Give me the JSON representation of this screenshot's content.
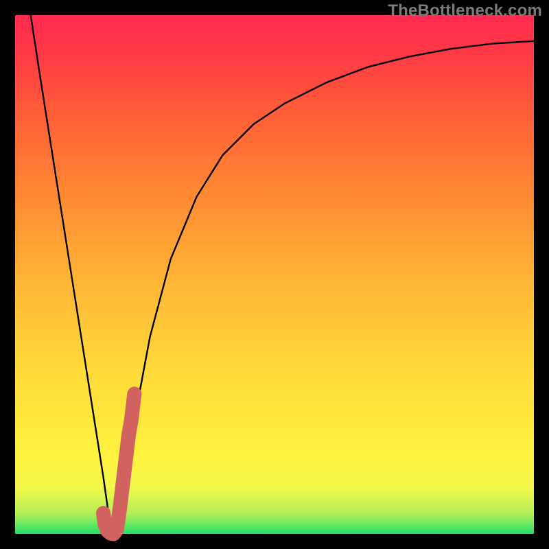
{
  "watermark": {
    "text": "TheBottleneck.com"
  },
  "colors": {
    "background": "#000000",
    "curve": "#000000",
    "highlight": "#d1625f",
    "gradient_stops": [
      "#1fe06a",
      "#6fe85f",
      "#b6ef57",
      "#f3f84b",
      "#fef23f",
      "#ffd93a",
      "#ffb236",
      "#ff8533",
      "#ff5b39",
      "#ff3b45",
      "#ff2a50"
    ]
  },
  "chart_data": {
    "type": "line",
    "title": "",
    "xlabel": "",
    "ylabel": "",
    "xlim": [
      0,
      100
    ],
    "ylim": [
      0,
      100
    ],
    "series": [
      {
        "name": "bottleneck-curve",
        "x": [
          3,
          5,
          8,
          11,
          14,
          17,
          18,
          19,
          21,
          23,
          26,
          30,
          35,
          40,
          46,
          52,
          60,
          68,
          76,
          84,
          92,
          100
        ],
        "y": [
          100,
          87,
          68,
          49,
          30,
          11,
          4,
          0,
          10,
          22,
          38,
          53,
          65,
          73,
          79,
          83,
          87,
          90,
          92,
          93.5,
          94.5,
          95
        ]
      },
      {
        "name": "highlight-j",
        "x": [
          17.0,
          17.3,
          17.8,
          18.4,
          19.0,
          19.6,
          20.2,
          20.8,
          21.4,
          22.0,
          22.5,
          23.0
        ],
        "y": [
          4.0,
          1.8,
          0.6,
          0.1,
          0.0,
          0.8,
          5.0,
          10.0,
          15.0,
          20.0,
          24.0,
          27.0
        ]
      }
    ]
  }
}
